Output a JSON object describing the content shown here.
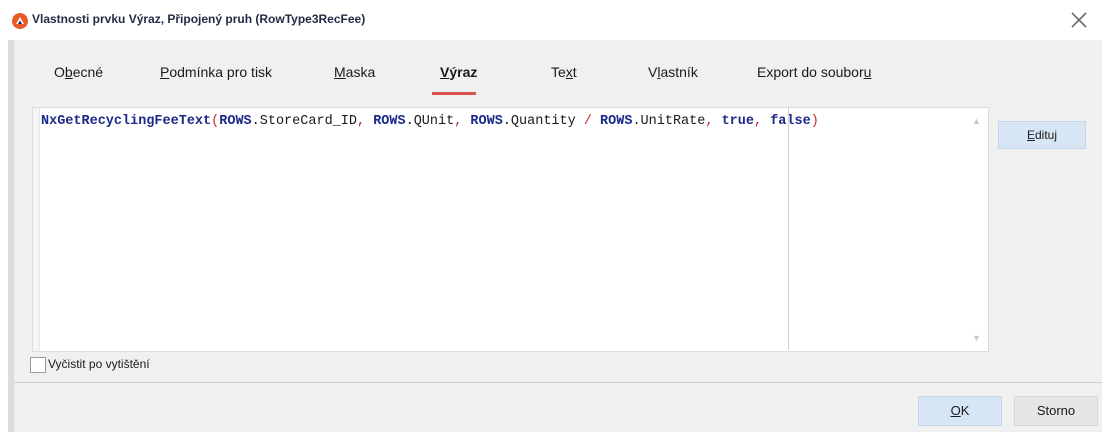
{
  "window": {
    "title": "Vlastnosti prvku Výraz, Připojený pruh (RowType3RecFee)",
    "icon": "app-logo-icon",
    "close_icon": "close-icon"
  },
  "tabs": [
    {
      "label_pre": "O",
      "label_u": "b",
      "label_post": "ecné"
    },
    {
      "label_pre": "",
      "label_u": "P",
      "label_post": "odmínka pro tisk"
    },
    {
      "label_pre": "",
      "label_u": "M",
      "label_post": "aska"
    },
    {
      "label_pre": "",
      "label_u": "V",
      "label_post": "ýraz"
    },
    {
      "label_pre": "Te",
      "label_u": "x",
      "label_post": "t"
    },
    {
      "label_pre": "V",
      "label_u": "l",
      "label_post": "astník"
    },
    {
      "label_pre": "Export do soubor",
      "label_u": "u",
      "label_post": ""
    }
  ],
  "active_tab": "Výraz",
  "expression": {
    "fn": "NxGetRecyclingFeeText",
    "p1": "(",
    "rows1": "ROWS",
    "f1": ".StoreCard_ID",
    "c1": ", ",
    "rows2": "ROWS",
    "f2": ".QUnit",
    "c2": ", ",
    "rows3": "ROWS",
    "f3": ".Quantity ",
    "slash": "/",
    "sp": " ",
    "rows4": "ROWS",
    "f4": ".UnitRate",
    "c3": ", ",
    "kw_true": "true",
    "c4": ", ",
    "kw_false": "false",
    "p2": ")"
  },
  "edit_button": {
    "label_u": "E",
    "label_post": "dituj"
  },
  "checkbox": {
    "label": "Vyčistit po vytištění",
    "checked": false
  },
  "buttons": {
    "ok_u": "O",
    "ok_post": "K",
    "storno": "Storno"
  },
  "colors": {
    "accent": "#d9534f",
    "button_blue": "#d7e6f5",
    "code_keyword": "#1c2a8a",
    "code_operator": "#c0282d"
  }
}
